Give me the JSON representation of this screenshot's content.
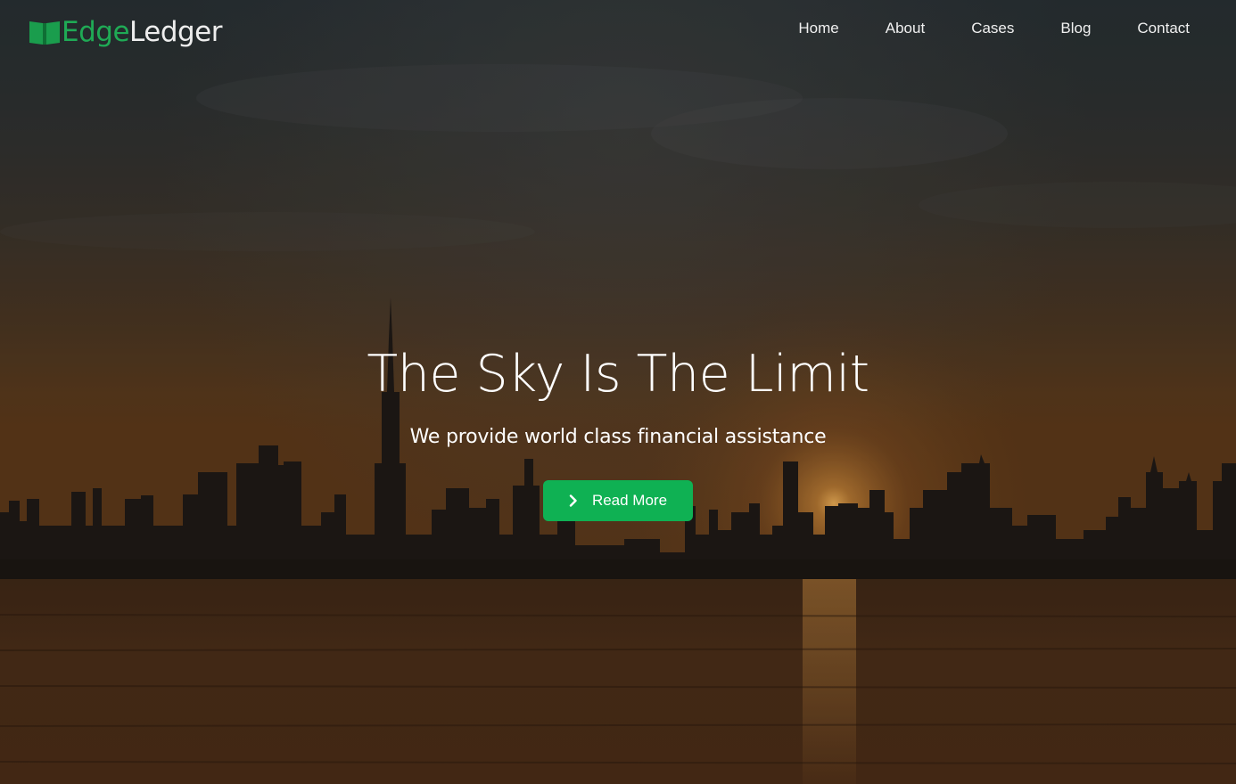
{
  "brand": {
    "name_part1": "Edge",
    "name_part2": "Ledger",
    "logo_icon": "open-book-icon",
    "accent_color": "#1faa55"
  },
  "nav": {
    "items": [
      {
        "label": "Home"
      },
      {
        "label": "About"
      },
      {
        "label": "Cases"
      },
      {
        "label": "Blog"
      },
      {
        "label": "Contact"
      }
    ]
  },
  "hero": {
    "title": "The Sky Is The Limit",
    "subtitle": "We provide world class financial assistance",
    "cta_label": "Read More",
    "cta_icon": "chevron-right-icon",
    "cta_color": "#0fb153",
    "background": "city-skyline-sunset-image"
  }
}
